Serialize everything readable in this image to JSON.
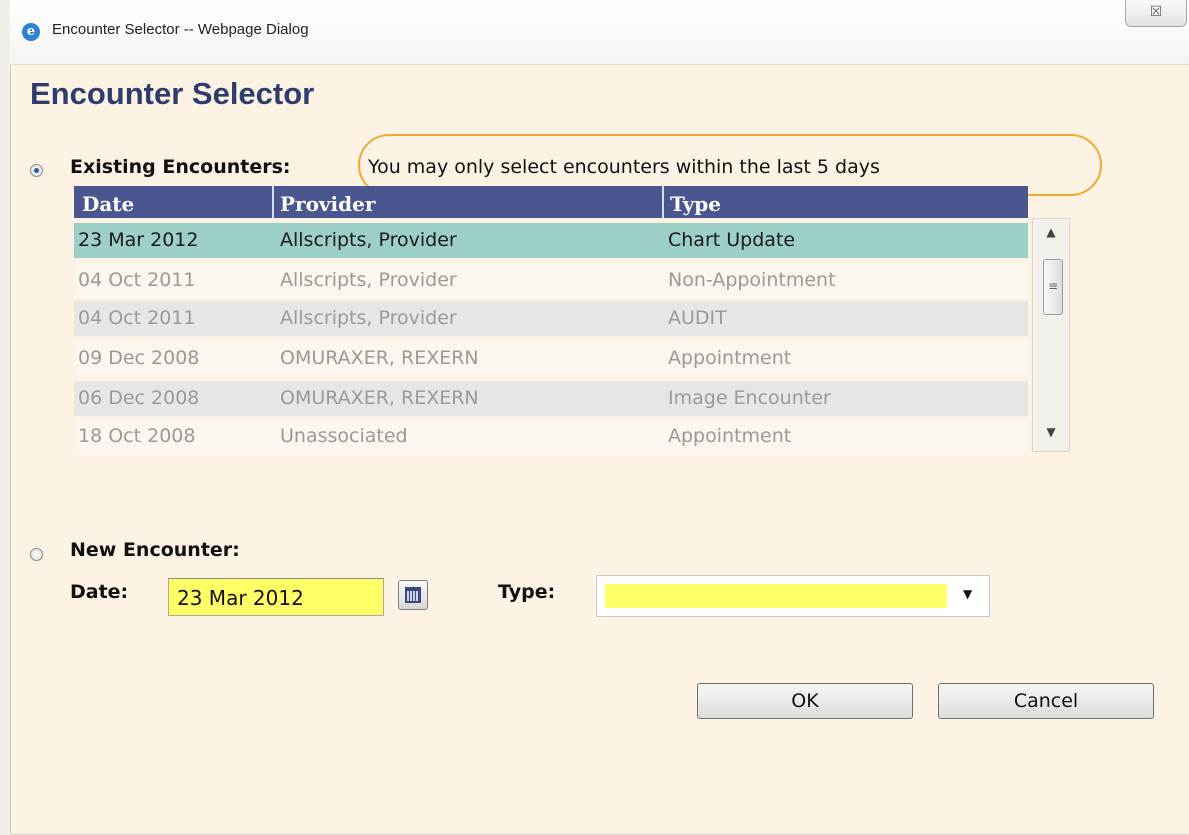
{
  "window": {
    "title": "Encounter Selector -- Webpage Dialog",
    "close_label": "☒"
  },
  "dialog": {
    "heading": "Encounter Selector"
  },
  "existing": {
    "label": "Existing Encounters:",
    "note": "You may only select encounters within the last 5 days",
    "selected": true
  },
  "grid": {
    "headers": [
      "Date",
      "Provider",
      "Type"
    ],
    "rows": [
      {
        "date": "23 Mar 2012",
        "provider": "Allscripts, Provider",
        "type": "Chart Update",
        "selected": true
      },
      {
        "date": "04 Oct 2011",
        "provider": "Allscripts, Provider",
        "type": "Non-Appointment"
      },
      {
        "date": "04 Oct 2011",
        "provider": "Allscripts, Provider",
        "type": "AUDIT"
      },
      {
        "date": "09 Dec 2008",
        "provider": "OMURAXER, REXERN",
        "type": "Appointment"
      },
      {
        "date": "06 Dec 2008",
        "provider": "OMURAXER, REXERN",
        "type": "Image Encounter"
      },
      {
        "date": "18 Oct 2008",
        "provider": "Unassociated",
        "type": "Appointment"
      }
    ]
  },
  "new_encounter": {
    "label": "New Encounter:",
    "selected": false,
    "date_label": "Date:",
    "date_value": "23 Mar 2012",
    "type_label": "Type:",
    "type_value": ""
  },
  "buttons": {
    "ok": "OK",
    "cancel": "Cancel"
  },
  "colors": {
    "header_bg": "#4a5690",
    "selected_row": "#9ccfc8",
    "required_field": "#ffff66",
    "highlight_oval": "#f0a830"
  }
}
